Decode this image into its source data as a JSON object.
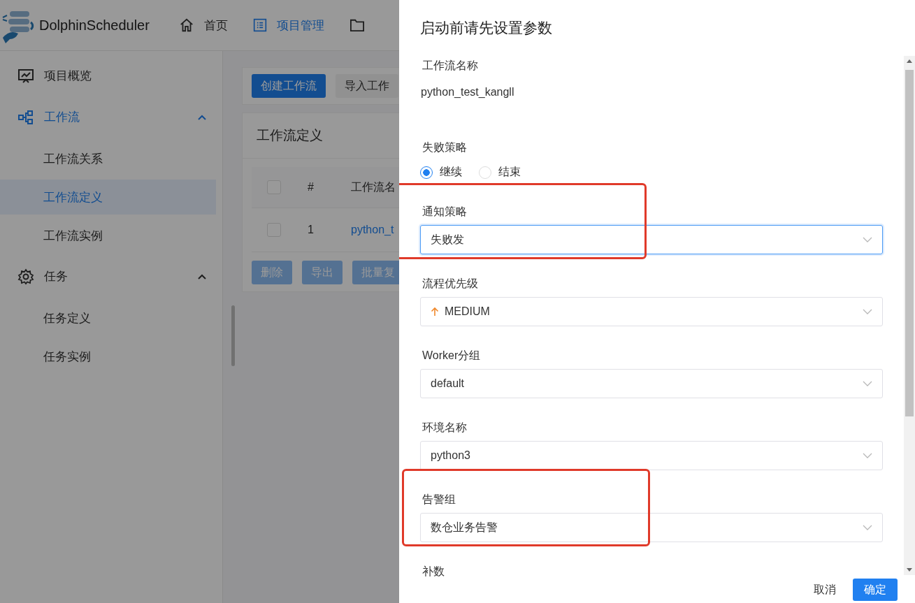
{
  "header": {
    "brand": "DolphinScheduler",
    "nav": [
      {
        "kind": "home",
        "label": "首页",
        "selected": false
      },
      {
        "kind": "list",
        "label": "项目管理",
        "selected": true
      },
      {
        "kind": "folder",
        "selected": false
      }
    ]
  },
  "sidebar": {
    "items": [
      {
        "kind": "monitor",
        "label": "项目概览",
        "selected": false
      },
      {
        "kind": "flow",
        "label": "工作流",
        "selected": true,
        "expanded": true,
        "children": [
          {
            "label": "工作流关系",
            "selected": false
          },
          {
            "label": "工作流定义",
            "selected": true
          },
          {
            "label": "工作流实例",
            "selected": false
          }
        ]
      },
      {
        "kind": "gear",
        "label": "任务",
        "selected": false,
        "expanded": true,
        "children": [
          {
            "label": "任务定义",
            "selected": false
          },
          {
            "label": "任务实例",
            "selected": false
          }
        ]
      }
    ]
  },
  "toolbar": {
    "buttons": [
      {
        "label": "创建工作流",
        "primary": true
      },
      {
        "label": "导入工作",
        "primary": false
      }
    ]
  },
  "definition_card": {
    "title": "工作流定义",
    "table": {
      "header_checked": false,
      "columns": [
        "#",
        "工作流名"
      ],
      "rows": [
        {
          "checked": false,
          "cells": [
            "1",
            "python_t"
          ]
        }
      ]
    },
    "batch_buttons": [
      "删除",
      "导出",
      "批量复"
    ]
  },
  "drawer": {
    "title": "启动前请先设置参数",
    "fields": [
      {
        "kind": "text",
        "label": "工作流名称",
        "value": "python_test_kangll",
        "highlighted": false
      },
      {
        "kind": "radio",
        "label": "失败策略",
        "options": [
          {
            "label": "继续",
            "selected": true
          },
          {
            "label": "结束",
            "selected": false
          }
        ],
        "highlighted": false
      },
      {
        "kind": "select",
        "label": "通知策略",
        "value": "失败发",
        "focused": true,
        "highlighted": true
      },
      {
        "kind": "priority",
        "label": "流程优先级",
        "value": "MEDIUM",
        "focused": false,
        "highlighted": false
      },
      {
        "kind": "select",
        "label": "Worker分组",
        "value": "default",
        "focused": false,
        "highlighted": false
      },
      {
        "kind": "select",
        "label": "环境名称",
        "value": "python3",
        "focused": false,
        "highlighted": false
      },
      {
        "kind": "select",
        "label": "告警组",
        "value": "数仓业务告警",
        "focused": false,
        "highlighted": true
      },
      {
        "kind": "label",
        "label": "补数",
        "highlighted": false
      }
    ],
    "buttons": [
      {
        "label": "取消",
        "primary": false
      },
      {
        "label": "确定",
        "primary": true
      }
    ]
  }
}
